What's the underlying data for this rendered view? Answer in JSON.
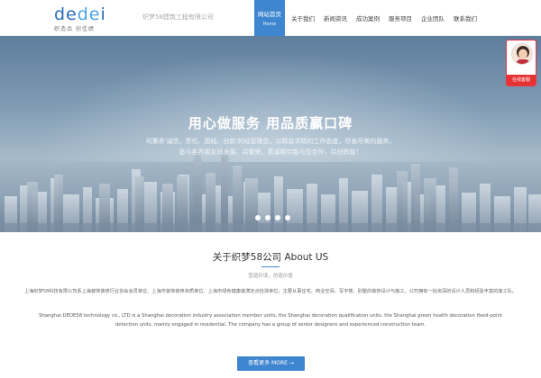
{
  "header": {
    "logo_text_a": "de",
    "logo_text_b": "de",
    "logo_text_c": "i",
    "logo_sub": "织造品 创佳绩",
    "tagline": "织梦58建筑工程有限公司",
    "nav": [
      {
        "label": "网站首页",
        "sub": "Home",
        "active": true
      },
      {
        "label": "关于我们"
      },
      {
        "label": "新闻资讯"
      },
      {
        "label": "成功案例"
      },
      {
        "label": "服务项目"
      },
      {
        "label": "企业团队"
      },
      {
        "label": "联系我们"
      }
    ]
  },
  "hero": {
    "title": "用心做服务 用品质赢口碑",
    "line1": "司秉承'诚信、责任、团结、创新'的经营理念，以精益求精的工作态度，尽善尽美的服务，",
    "line2": "愿与各界朋友同发展、共繁荣，真诚期待能与您合作，共创辉煌！",
    "slides": 4
  },
  "service": {
    "label": "在线客服"
  },
  "about": {
    "title": "关于织梦58公司 About US",
    "subtitle": "营造环境，创造价值",
    "cn_text": "上海织梦58科技有限公司系上海装饰装修行业协会会员单位、上海市装饰装修资质单位、上海市绿色健康装潢定点检测单位，主要从事住宅、商业空间、写字楼、别墅的装饰设计与施工。公司拥有一批资深的设计人员和经验丰富的施工队。",
    "en_text": "Shanghai DEDE58 technology co., LTD is a Shanghai decoration industry association member units, the Shanghai decoration qualification units, the Shanghai green health decoration fixed-point detection units, mainly engaged in residential. The company has a group of senior designers and experienced construction team.",
    "more_label": "查看更多 MORE →"
  },
  "colors": {
    "accent": "#3f86d0",
    "service_red": "#e63232"
  }
}
